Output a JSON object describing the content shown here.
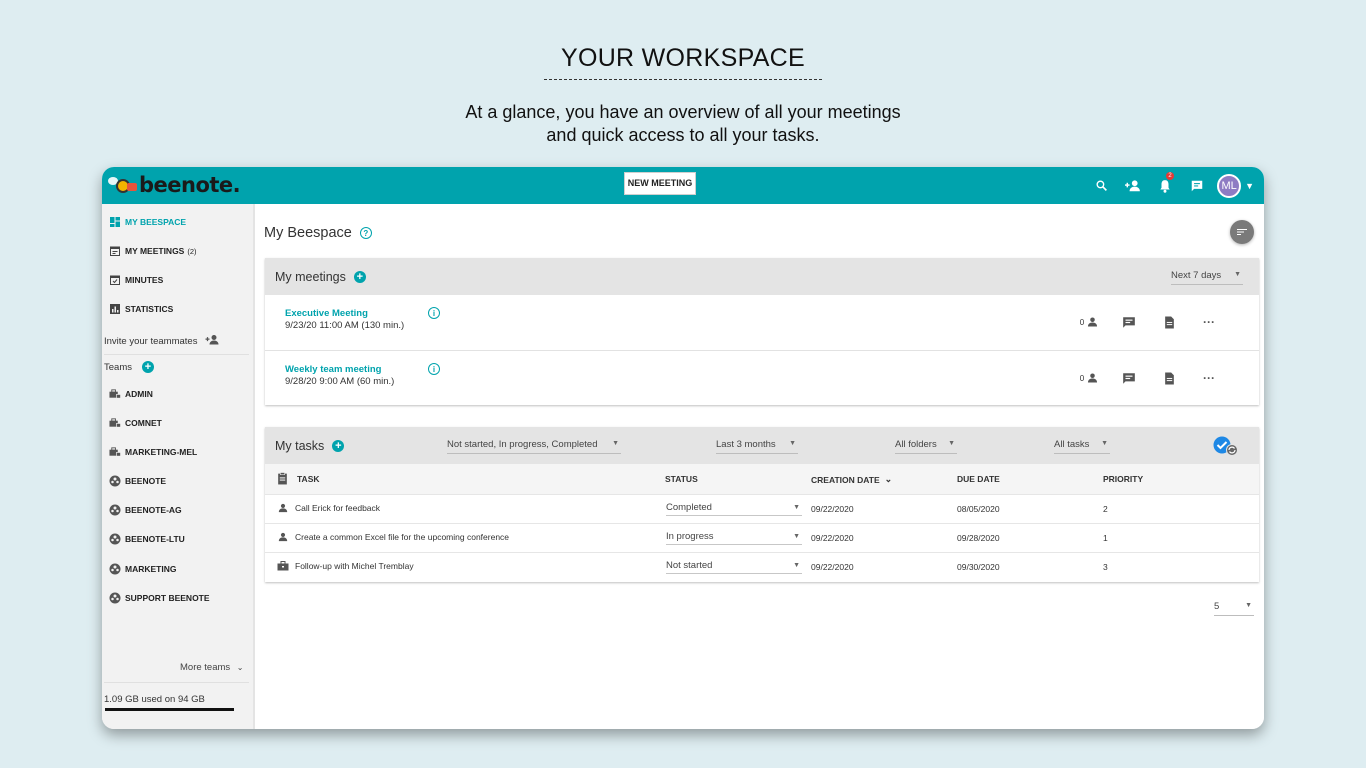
{
  "hero": {
    "title": "YOUR WORKSPACE",
    "subtitle_line1": "At a glance, you have an overview of all your meetings",
    "subtitle_line2": "and quick access to all your tasks."
  },
  "topbar": {
    "logo_text": "beenote.",
    "new_meeting_label": "NEW MEETING",
    "notification_count": "2",
    "avatar_initials": "ML",
    "accent_color": "#00a3ad"
  },
  "sidebar": {
    "items": [
      {
        "label": "MY BEESPACE",
        "icon": "dashboard-icon"
      },
      {
        "label": "MY MEETINGS",
        "count": "(2)",
        "icon": "calendar-icon"
      },
      {
        "label": "MINUTES",
        "icon": "calendar-check-icon"
      },
      {
        "label": "STATISTICS",
        "icon": "bar-chart-icon"
      }
    ],
    "invite_label": "Invite your teammates",
    "teams_label": "Teams",
    "teams": [
      {
        "label": "ADMIN",
        "icon": "briefcase-lock-icon"
      },
      {
        "label": "COMNET",
        "icon": "briefcase-lock-icon"
      },
      {
        "label": "MARKETING-MEL",
        "icon": "briefcase-lock-icon"
      },
      {
        "label": "BEENOTE",
        "icon": "team-icon"
      },
      {
        "label": "BEENOTE-AG",
        "icon": "team-icon"
      },
      {
        "label": "BEENOTE-LTU",
        "icon": "team-icon"
      },
      {
        "label": "MARKETING",
        "icon": "team-icon"
      },
      {
        "label": "SUPPORT BEENOTE",
        "icon": "team-icon"
      }
    ],
    "more_teams_label": "More teams",
    "storage_text": "1.09 GB used on 94 GB"
  },
  "main": {
    "page_title": "My Beespace",
    "meetings": {
      "title": "My meetings",
      "filter": "Next 7 days",
      "rows": [
        {
          "name": "Executive Meeting",
          "date": "9/23/20 11:00 AM (130 min.)",
          "participants": "0"
        },
        {
          "name": "Weekly team meeting",
          "date": "9/28/20 9:00 AM (60 min.)",
          "participants": "0"
        }
      ]
    },
    "tasks": {
      "title": "My tasks",
      "filter_status": "Not started, In progress, Completed",
      "filter_period": "Last 3 months",
      "filter_folders": "All folders",
      "filter_tasks": "All tasks",
      "columns": {
        "task": "TASK",
        "status": "STATUS",
        "creation_date": "CREATION DATE",
        "due_date": "DUE DATE",
        "priority": "PRIORITY"
      },
      "rows": [
        {
          "task": "Call Erick for feedback",
          "icon": "person-icon",
          "status": "Completed",
          "created": "09/22/2020",
          "due": "08/05/2020",
          "priority": "2"
        },
        {
          "task": "Create a common Excel file for the upcoming conference",
          "icon": "person-icon",
          "status": "In progress",
          "created": "09/22/2020",
          "due": "09/28/2020",
          "priority": "1"
        },
        {
          "task": "Follow-up with Michel Tremblay",
          "icon": "briefcase-icon",
          "status": "Not started",
          "created": "09/22/2020",
          "due": "09/30/2020",
          "priority": "3"
        }
      ],
      "page_size": "5"
    }
  }
}
